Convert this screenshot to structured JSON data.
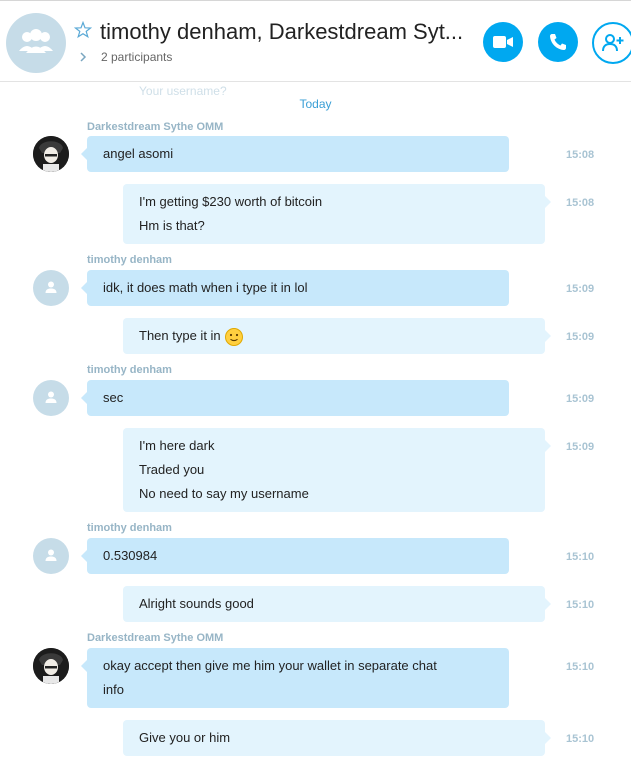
{
  "header": {
    "title": "timothy denham, Darkestdream Syt...",
    "participants": "2 participants"
  },
  "ghost_text": "Your username?",
  "date_divider": "Today",
  "messages": [
    {
      "sender": "Darkestdream Sythe OMM",
      "lines": [
        "angel asomi"
      ],
      "time": "15:08"
    },
    {
      "lines": [
        "I'm getting $230 worth of bitcoin",
        "Hm is that?"
      ],
      "time": "15:08"
    },
    {
      "sender": "timothy denham",
      "lines": [
        "idk, it does math when i type it in lol"
      ],
      "time": "15:09"
    },
    {
      "lines": [
        "Then type it in"
      ],
      "time": "15:09",
      "emoji": "slight-smile-emoji"
    },
    {
      "sender": "timothy denham",
      "lines": [
        "sec"
      ],
      "time": "15:09"
    },
    {
      "lines": [
        "I'm here dark",
        "Traded you",
        "No need to say my username"
      ],
      "time": "15:09"
    },
    {
      "sender": "timothy denham",
      "lines": [
        "0.530984"
      ],
      "time": "15:10"
    },
    {
      "lines": [
        "Alright sounds good"
      ],
      "time": "15:10"
    },
    {
      "sender": "Darkestdream Sythe OMM",
      "lines": [
        "okay accept then give me him your wallet in separate chat",
        "info"
      ],
      "time": "15:10"
    },
    {
      "lines": [
        "Give you or him"
      ],
      "time": "15:10"
    }
  ],
  "colors": {
    "accent": "#00a8f0",
    "incoming_bubble": "#c7e8fb",
    "outgoing_bubble": "#e3f4fd",
    "sender_name": "#97b5c6",
    "timestamp": "#a9c4d3"
  },
  "icons": [
    "group-icon",
    "star-icon",
    "chevron-right-icon",
    "video-call-icon",
    "phone-icon",
    "add-person-icon",
    "user-icon"
  ]
}
